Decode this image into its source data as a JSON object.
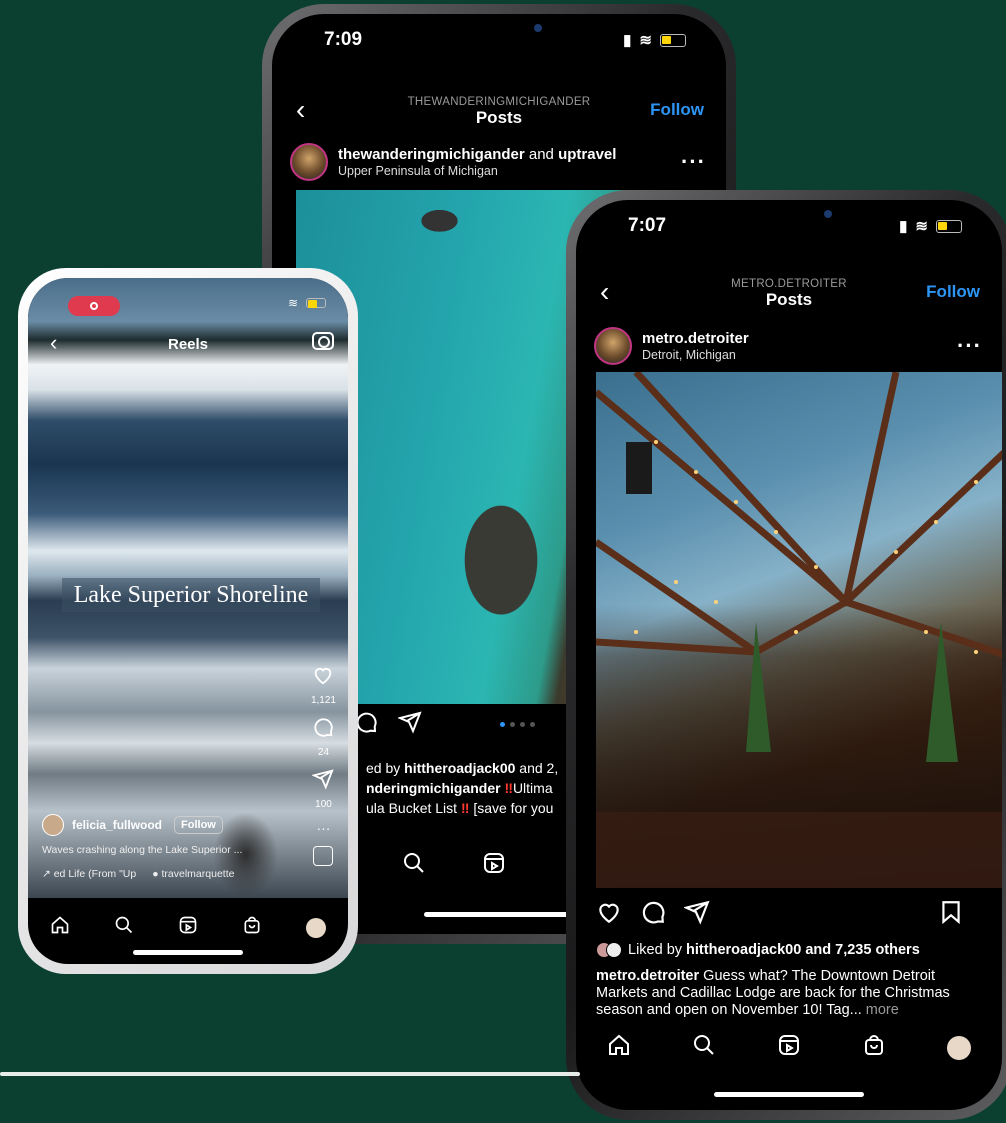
{
  "phone_michigander": {
    "time": "7:09",
    "header_subtitle": "THEWANDERINGMICHIGANDER",
    "header_title": "Posts",
    "follow_label": "Follow",
    "post_user": "thewanderingmichigander",
    "post_and": " and ",
    "post_coauthor": "uptravel",
    "post_location": "Upper Peninsula of Michigan",
    "liked_prefix": "ed by ",
    "liked_user": "hittheroadjack00",
    "liked_suffix": " and 2,",
    "caption_user": "nderingmichigander",
    "caption_text": "Ultima",
    "caption_line2a": "ula Bucket List",
    "caption_line2b": "[save for you"
  },
  "phone_detroiter": {
    "time": "7:07",
    "header_subtitle": "METRO.DETROITER",
    "header_title": "Posts",
    "follow_label": "Follow",
    "post_user": "metro.detroiter",
    "post_location": "Detroit, Michigan",
    "liked_prefix": "Liked by ",
    "liked_user": "hittheroadjack00",
    "liked_suffix": " and 7,235 others",
    "caption_user": "metro.detroiter",
    "caption_text": " Guess what? The Downtown Detroit Markets and Cadillac Lodge are back for the Christmas season and open on November 10! Tag...",
    "caption_more": " more"
  },
  "phone_reels": {
    "title": "Reels",
    "overlay_text": "Lake Superior Shoreline",
    "like_count": "1,121",
    "comment_count": "24",
    "share_count": "100",
    "username": "felicia_fullwood",
    "follow_label": "Follow",
    "description": "Waves crashing along the Lake Superior ...",
    "audio": "ed Life (From \"Up",
    "tagged_user": "travelmarquette"
  },
  "colors": {
    "background": "#0b3f30",
    "follow_blue": "#2d95f6",
    "record_red": "#e03a4e"
  },
  "icons": [
    "back-icon",
    "more-icon",
    "heart-icon",
    "comment-icon",
    "share-icon",
    "save-icon",
    "home-icon",
    "search-icon",
    "reels-icon",
    "shop-icon",
    "camera-icon"
  ]
}
